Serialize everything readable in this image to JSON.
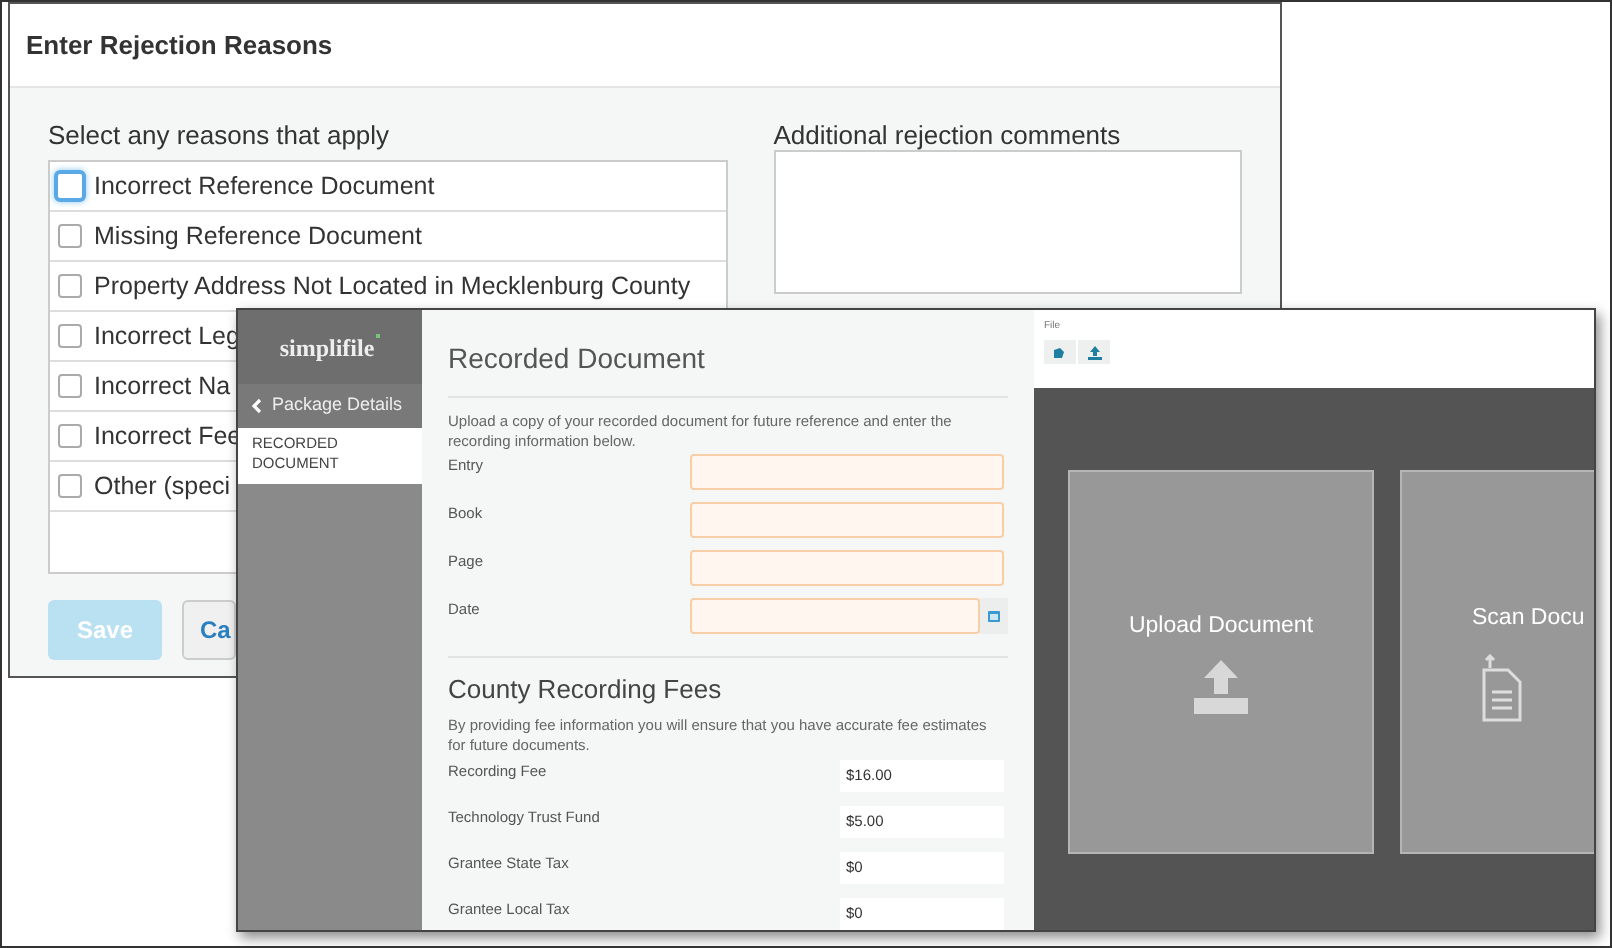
{
  "rejection_dialog": {
    "title": "Enter Rejection Reasons",
    "reasons_label": "Select any reasons that apply",
    "reasons": [
      {
        "label": "Incorrect Reference Document",
        "checked": false,
        "focused": true
      },
      {
        "label": "Missing Reference Document",
        "checked": false,
        "focused": false
      },
      {
        "label": "Property Address Not Located in Mecklenburg County",
        "checked": false,
        "focused": false
      },
      {
        "label": "Incorrect Leg",
        "checked": false,
        "focused": false
      },
      {
        "label": "Incorrect Na",
        "checked": false,
        "focused": false
      },
      {
        "label": "Incorrect Fee",
        "checked": false,
        "focused": false
      },
      {
        "label": "Other (speci",
        "checked": false,
        "focused": false
      }
    ],
    "comments_label": "Additional rejection comments",
    "buttons": [
      {
        "label": "Save",
        "kind": "primary",
        "disabled": true
      },
      {
        "label": "Ca",
        "kind": "secondary",
        "disabled": false
      }
    ]
  },
  "recorded_window": {
    "logo": "simplifile",
    "sidebar": {
      "back_link": "Package Details",
      "items": [
        {
          "label": "RECORDED DOCUMENT",
          "selected": true
        }
      ]
    },
    "title": "Recorded Document",
    "description": "Upload a copy of your recorded document for future reference and enter the recording information below.",
    "fields": [
      {
        "label": "Entry",
        "kind": "text"
      },
      {
        "label": "Book",
        "kind": "text"
      },
      {
        "label": "Page",
        "kind": "text"
      },
      {
        "label": "Date",
        "kind": "date"
      }
    ],
    "fees_title": "County Recording Fees",
    "fees_description": "By providing fee information you will ensure that you have accurate fee estimates for future documents.",
    "fees": [
      {
        "label": "Recording Fee",
        "value": "$16.00"
      },
      {
        "label": "Technology Trust Fund",
        "value": "$5.00"
      },
      {
        "label": "Grantee State Tax",
        "value": "$0"
      },
      {
        "label": "Grantee Local Tax",
        "value": "$0"
      }
    ],
    "toolbar_label": "File",
    "cards": [
      {
        "label": "Upload Document",
        "kind": "upload"
      },
      {
        "label": "Scan Docu",
        "kind": "scan"
      }
    ]
  }
}
